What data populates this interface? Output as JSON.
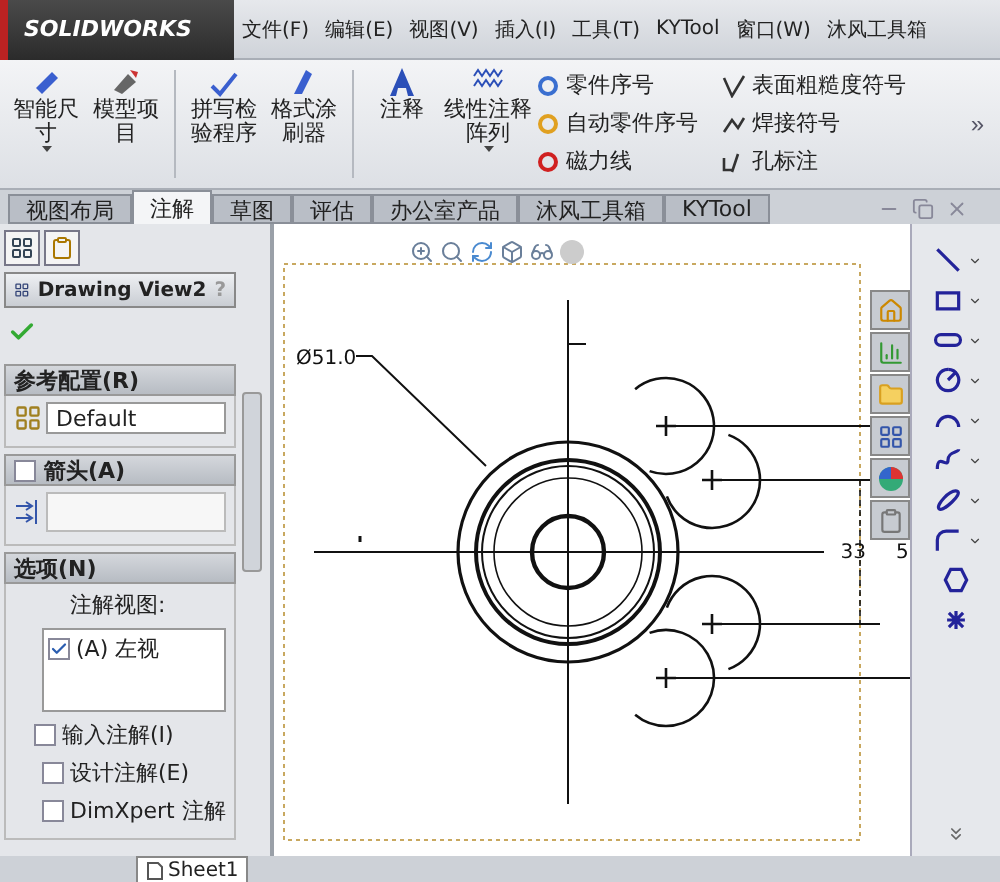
{
  "title_bar": {
    "logo": "SOLIDWORKS",
    "menu": [
      "文件(F)",
      "编辑(E)",
      "视图(V)",
      "插入(I)",
      "工具(T)",
      "KYTool",
      "窗口(W)",
      "沐风工具箱"
    ]
  },
  "ribbon": {
    "large_buttons": [
      {
        "label": "智能尺寸",
        "dropdown": true
      },
      {
        "label": "模型项目",
        "dropdown": false
      },
      {
        "label": "拼写检验程序",
        "dropdown": false
      },
      {
        "label": "格式涂刷器",
        "dropdown": false
      },
      {
        "label": "注释",
        "dropdown": false
      },
      {
        "label": "线性注释阵列",
        "dropdown": true
      }
    ],
    "small_buttons": [
      "零件序号",
      "自动零件序号",
      "磁力线",
      "表面粗糙度符号",
      "焊接符号",
      "孔标注"
    ],
    "overflow": "»"
  },
  "tabs": [
    {
      "label": "视图布局",
      "selected": false
    },
    {
      "label": "注解",
      "selected": true
    },
    {
      "label": "草图",
      "selected": false
    },
    {
      "label": "评估",
      "selected": false
    },
    {
      "label": "办公室产品",
      "selected": false
    },
    {
      "label": "沐风工具箱",
      "selected": false
    },
    {
      "label": "KYTool",
      "selected": false
    }
  ],
  "property_manager": {
    "title": "Drawing View2",
    "help": "?",
    "sections": [
      {
        "kind": "config",
        "title": "参考配置(R)",
        "value": "Default"
      },
      {
        "kind": "arrow",
        "title": "箭头(A)",
        "checked": false
      },
      {
        "kind": "options",
        "title": "选项(N)",
        "label": "注解视图:",
        "views": [
          {
            "label": "(A) 左视",
            "checked": true
          }
        ],
        "options": [
          {
            "label": "输入注解(I)",
            "checked": false,
            "children": [
              {
                "label": "设计注解(E)",
                "checked": false
              },
              {
                "label": "DimXpert 注解",
                "checked": false
              }
            ]
          }
        ]
      }
    ]
  },
  "drawing": {
    "diameter_label": "Ø51.0",
    "dimension": "33",
    "dimension_2": "5"
  },
  "sheet_tabs": [
    {
      "label": "Sheet1",
      "selected": true
    }
  ]
}
